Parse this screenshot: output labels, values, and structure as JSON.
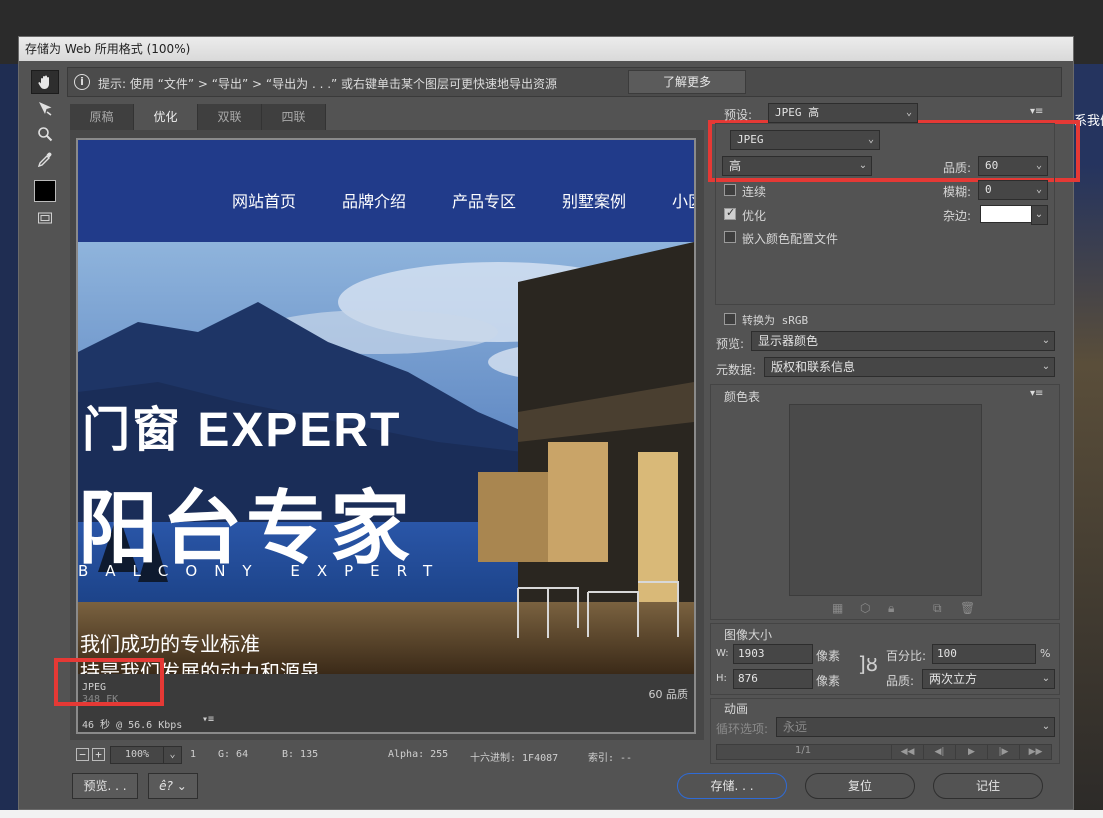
{
  "background": {
    "right_text": "系我们"
  },
  "dialog": {
    "title": "存储为 Web 所用格式 (100%)"
  },
  "hint": {
    "text": "提示: 使用 “文件” > “导出” > “导出为 . . .” 或右键单击某个图层可更快速地导出资源",
    "learn_more": "了解更多"
  },
  "tabs": [
    {
      "label": "原稿"
    },
    {
      "label": "优化",
      "active": true
    },
    {
      "label": "双联"
    },
    {
      "label": "四联"
    }
  ],
  "site": {
    "nav": [
      "网站首页",
      "品牌介绍",
      "产品专区",
      "别墅案例",
      "小区"
    ],
    "hero_line1": "门窗 EXPERT",
    "hero_line2": "阳台专家",
    "hero_line3": "BALCONY EXPERT",
    "hero_line4": "我们成功的专业标准",
    "hero_line5": "持是我们发展的动力和源泉"
  },
  "preview_info": {
    "format": "JPEG",
    "size": "348 FK",
    "speed": "46 秒 @ 56.6 Kbps",
    "menu": "▾≡",
    "quality": "60 品质"
  },
  "statusbar": {
    "zoom": "100%",
    "r": "1",
    "g": "G: 64",
    "b": "B: 135",
    "alpha": "Alpha: 255",
    "hex": "十六进制: 1F4087",
    "index": "索引: --"
  },
  "buttons": {
    "preview": "预览. . .",
    "save": "存储. . .",
    "reset": "复位",
    "remember": "记住",
    "browser_icon": "ê?"
  },
  "settings": {
    "preset_label": "预设:",
    "preset_value": "JPEG 高",
    "format_value": "JPEG",
    "quality_level": "高",
    "quality_label": "品质:",
    "quality_value": "60",
    "progressive_label": "连续",
    "progressive_checked": false,
    "blur_label": "模糊:",
    "blur_value": "0",
    "optimized_label": "优化",
    "optimized_checked": true,
    "matte_label": "杂边:",
    "embed_profile_label": "嵌入颜色配置文件",
    "embed_profile_checked": false,
    "convert_srgb_label": "转换为 sRGB",
    "convert_srgb_checked": false,
    "preview_label": "预览:",
    "preview_value": "显示器颜色",
    "metadata_label": "元数据:",
    "metadata_value": "版权和联系信息",
    "color_table_label": "颜色表"
  },
  "image_size": {
    "title": "图像大小",
    "w_label": "W:",
    "w_value": "1903",
    "h_label": "H:",
    "h_value": "876",
    "unit": "像素",
    "percent_label": "百分比:",
    "percent_value": "100",
    "percent_unit": "%",
    "quality_label": "品质:",
    "quality_value": "两次立方"
  },
  "animation": {
    "title": "动画",
    "loop_label": "循环选项:",
    "loop_value": "永远",
    "frame": "1/1"
  }
}
